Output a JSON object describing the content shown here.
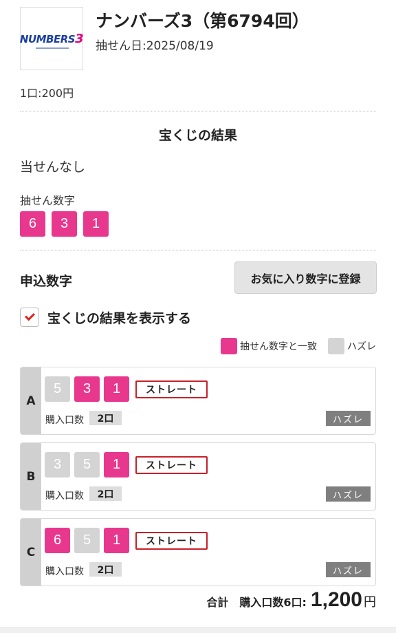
{
  "header": {
    "logo_text_main": "NUMBERS",
    "logo_text_digit": "3",
    "title": "ナンバーズ3（第6794回）",
    "draw_date": "抽せん日:2025/08/19"
  },
  "price": "1口:200円",
  "result": {
    "section_title": "宝くじの結果",
    "status": "当せんなし",
    "drawn_label": "抽せん数字",
    "drawn_numbers": [
      "6",
      "3",
      "1"
    ]
  },
  "apply": {
    "label": "申込数字",
    "favorite_button": "お気に入り数字に登録",
    "show_result_label": "宝くじの結果を表示する",
    "show_result_checked": true
  },
  "legend": {
    "match_label": "抽せん数字と一致",
    "miss_label": "ハズレ",
    "match_color": "#e8388e",
    "miss_color": "#d4d4d4"
  },
  "rows": [
    {
      "letter": "A",
      "numbers": [
        {
          "value": "5",
          "match": false
        },
        {
          "value": "3",
          "match": true
        },
        {
          "value": "1",
          "match": true
        }
      ],
      "type": "ストレート",
      "qty_label": "購入口数",
      "qty": "2口",
      "status": "ハズレ"
    },
    {
      "letter": "B",
      "numbers": [
        {
          "value": "3",
          "match": false
        },
        {
          "value": "5",
          "match": false
        },
        {
          "value": "1",
          "match": true
        }
      ],
      "type": "ストレート",
      "qty_label": "購入口数",
      "qty": "2口",
      "status": "ハズレ"
    },
    {
      "letter": "C",
      "numbers": [
        {
          "value": "6",
          "match": true
        },
        {
          "value": "5",
          "match": false
        },
        {
          "value": "1",
          "match": true
        }
      ],
      "type": "ストレート",
      "qty_label": "購入口数",
      "qty": "2口",
      "status": "ハズレ"
    }
  ],
  "total": {
    "label": "合計",
    "qty_label": "購入口数",
    "qty": "6口:",
    "amount": "1,200",
    "currency": "円"
  }
}
